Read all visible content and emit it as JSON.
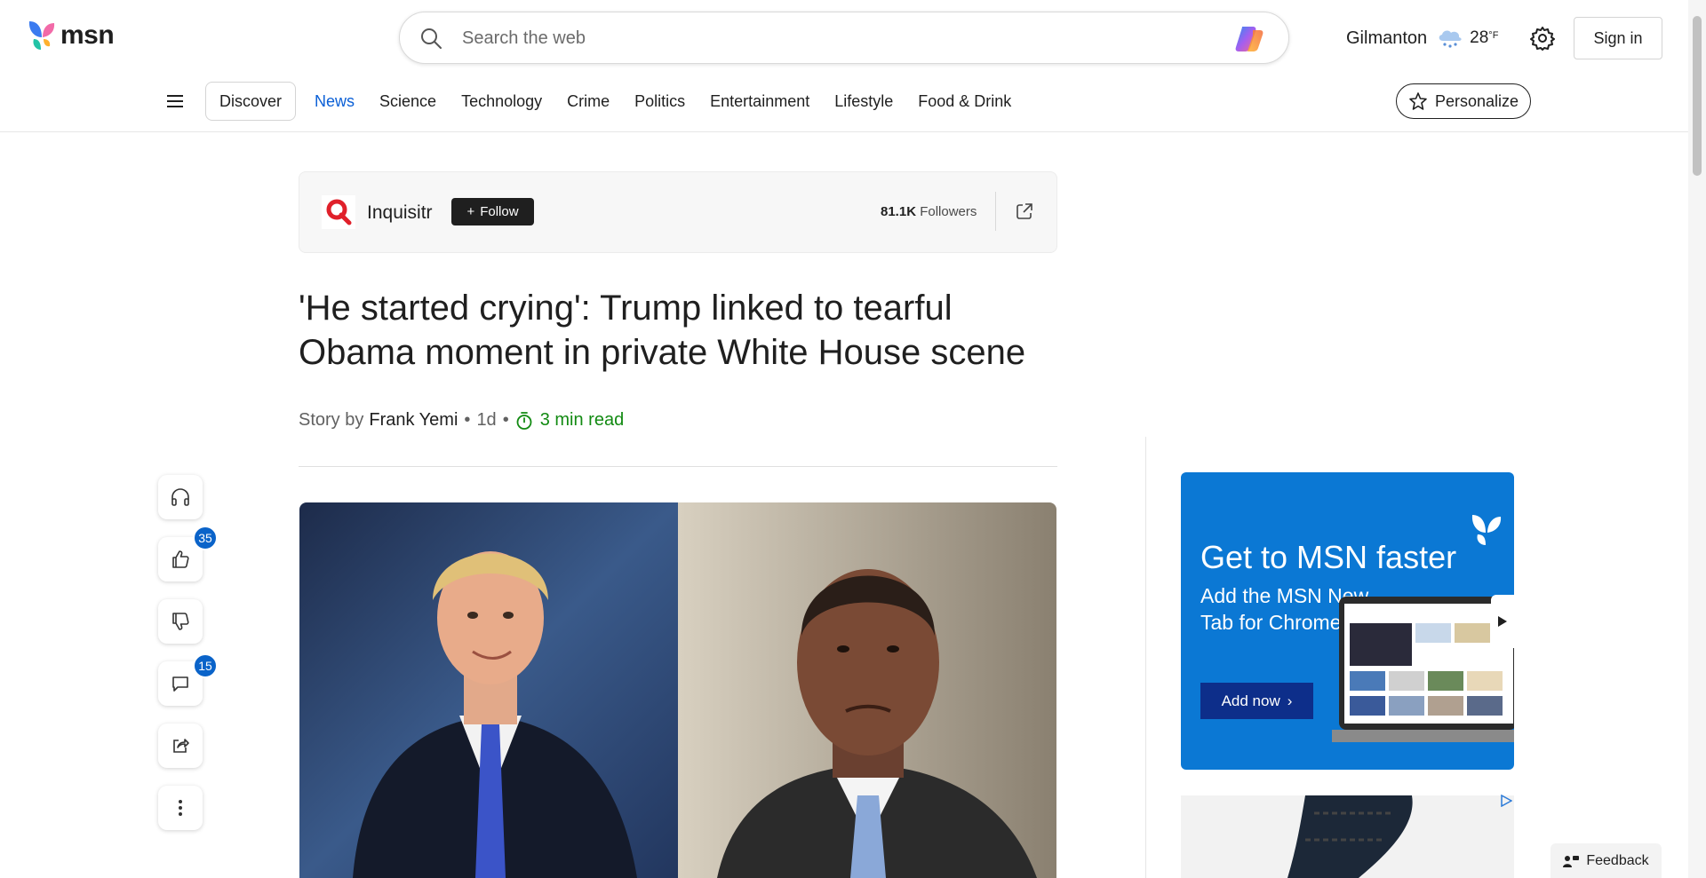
{
  "header": {
    "logo_text": "msn",
    "search": {
      "placeholder": "Search the web"
    },
    "weather": {
      "location": "Gilmanton",
      "temp": "28",
      "unit": "°F",
      "icon": "snow-cloud-icon"
    },
    "signin_label": "Sign in"
  },
  "nav": {
    "discover_label": "Discover",
    "links": [
      {
        "label": "News",
        "active": true
      },
      {
        "label": "Science"
      },
      {
        "label": "Technology"
      },
      {
        "label": "Crime"
      },
      {
        "label": "Politics"
      },
      {
        "label": "Entertainment"
      },
      {
        "label": "Lifestyle"
      },
      {
        "label": "Food & Drink"
      }
    ],
    "personalize_label": "Personalize"
  },
  "publisher": {
    "name": "Inquisitr",
    "follow_label": "Follow",
    "followers_count": "81.1K",
    "followers_label": "Followers"
  },
  "article": {
    "title": "'He started crying': Trump linked to tearful Obama moment in private White House scene",
    "story_by": "Story by",
    "author": "Frank Yemi",
    "age": "1d",
    "read_time": "3 min read"
  },
  "actions": {
    "likes": "35",
    "comments": "15"
  },
  "promo": {
    "title": "Get to MSN faster",
    "subtitle": "Add the MSN New Tab for Chrome",
    "button_label": "Add now"
  },
  "feedback_label": "Feedback",
  "colors": {
    "accent": "#0a5fd6",
    "read_time": "#128a12",
    "promo_bg": "#0b78d4",
    "badge": "#0a63c9"
  }
}
